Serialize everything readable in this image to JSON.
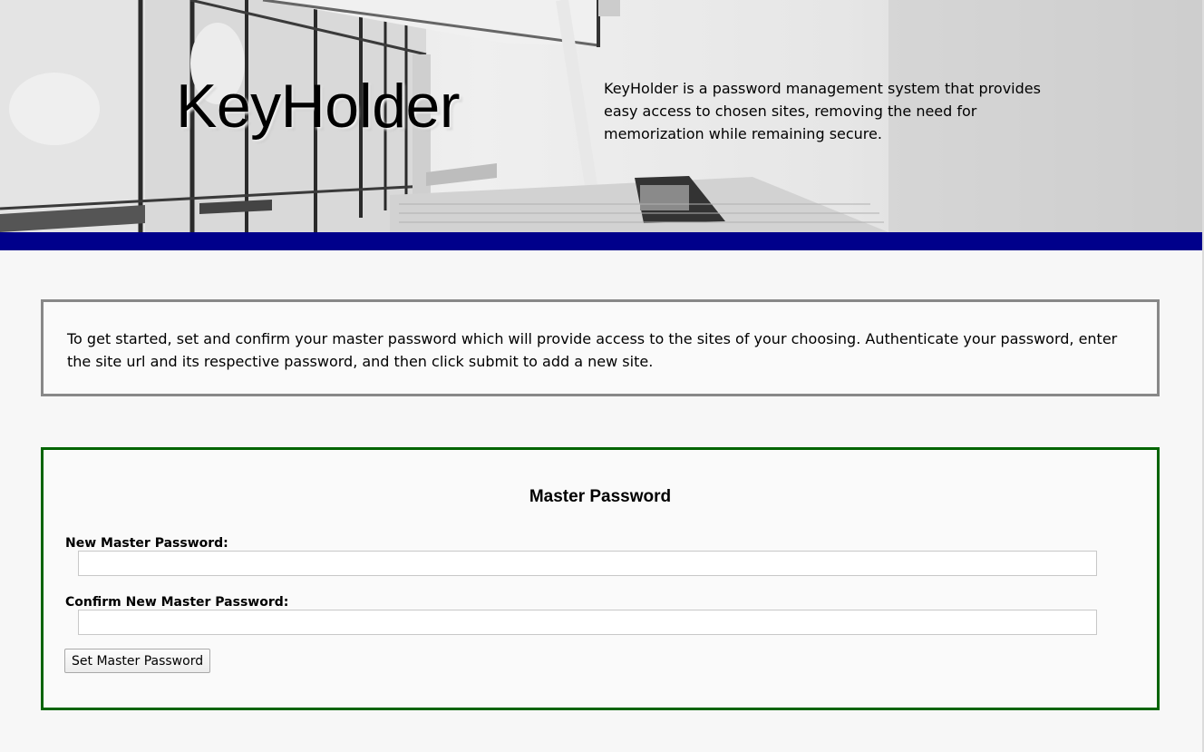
{
  "header": {
    "title": "KeyHolder",
    "tagline": "KeyHolder is a password management system that provides easy access to chosen sites, removing the need for memorization while remaining secure."
  },
  "intro": {
    "text": "To get started, set and confirm your master password which will provide access to the sites of your choosing. Authenticate your password, enter the site url and its respective password, and then click submit to add a new site."
  },
  "master_password_form": {
    "title": "Master Password",
    "new_label": "New Master Password:",
    "new_value": "",
    "confirm_label": "Confirm New Master Password:",
    "confirm_value": "",
    "submit_label": "Set Master Password"
  },
  "colors": {
    "header_bar": "#00008b",
    "intro_border": "#888888",
    "form_border": "#006400",
    "page_background": "#f7f7f7"
  }
}
